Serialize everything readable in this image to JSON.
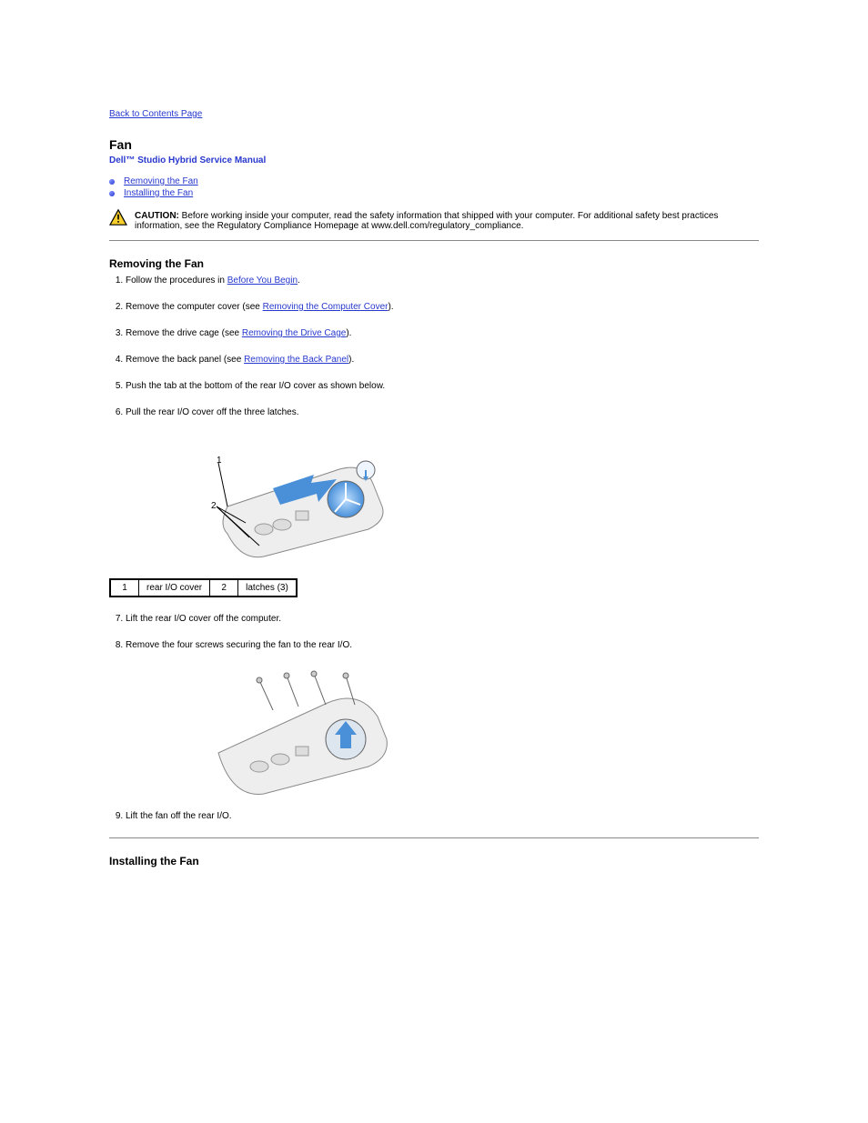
{
  "nav": {
    "back_link": "Back to Contents Page"
  },
  "header": {
    "page_title": "Fan",
    "manual_title": "Dell™ Studio Hybrid Service Manual"
  },
  "toc": {
    "items": [
      {
        "label": "Removing the Fan"
      },
      {
        "label": "Installing the Fan"
      }
    ]
  },
  "caution": {
    "label": "CAUTION:",
    "text": " Before working inside your computer, read the safety information that shipped with your computer. For additional safety best practices information, see the Regulatory Compliance Homepage at www.dell.com/regulatory_compliance."
  },
  "section_remove": {
    "heading": "Removing the Fan",
    "steps": {
      "s1_pre": "Follow the procedures in ",
      "s1_link": "Before You Begin",
      "s1_post": ".",
      "s2_pre": "Remove the computer cover (see ",
      "s2_link": "Removing the Computer Cover",
      "s2_post": ").",
      "s3_pre": "Remove the drive cage (see ",
      "s3_link": "Removing the Drive Cage",
      "s3_post": ").",
      "s4_pre": "Remove the back panel (see ",
      "s4_link": "Removing the Back Panel",
      "s4_post": ").",
      "s5": "Push the tab at the bottom of the rear I/O cover as shown below.",
      "s6": "Pull the rear I/O cover off the three latches.",
      "s7": "Lift the rear I/O cover off the computer.",
      "s8": "Remove the four screws securing the fan to the rear I/O.",
      "s9": "Lift the fan off the rear I/O."
    }
  },
  "parts_table": {
    "rows": [
      {
        "num": "1",
        "name": "rear I/O cover",
        "num2": "2",
        "name2": "latches (3)"
      }
    ]
  },
  "section_install": {
    "heading": "Installing the Fan"
  }
}
